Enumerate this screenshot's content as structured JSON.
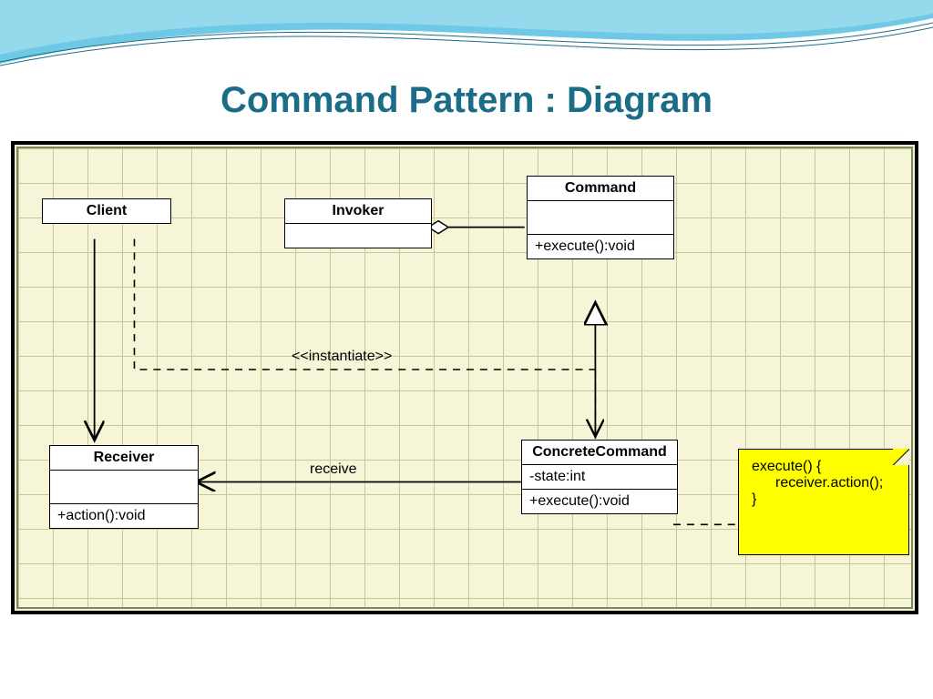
{
  "title": "Command Pattern : Diagram",
  "classes": {
    "client": {
      "name": "Client"
    },
    "invoker": {
      "name": "Invoker"
    },
    "command": {
      "name": "Command",
      "method": "+execute():void"
    },
    "receiver": {
      "name": "Receiver",
      "method": "+action():void"
    },
    "concrete": {
      "name": "ConcreteCommand",
      "attr": "-state:int",
      "method": "+execute():void"
    }
  },
  "labels": {
    "instantiate": "<<instantiate>>",
    "receive": "receive"
  },
  "note": {
    "line1": "execute() {",
    "line2": "receiver.action();",
    "line3": "}"
  }
}
